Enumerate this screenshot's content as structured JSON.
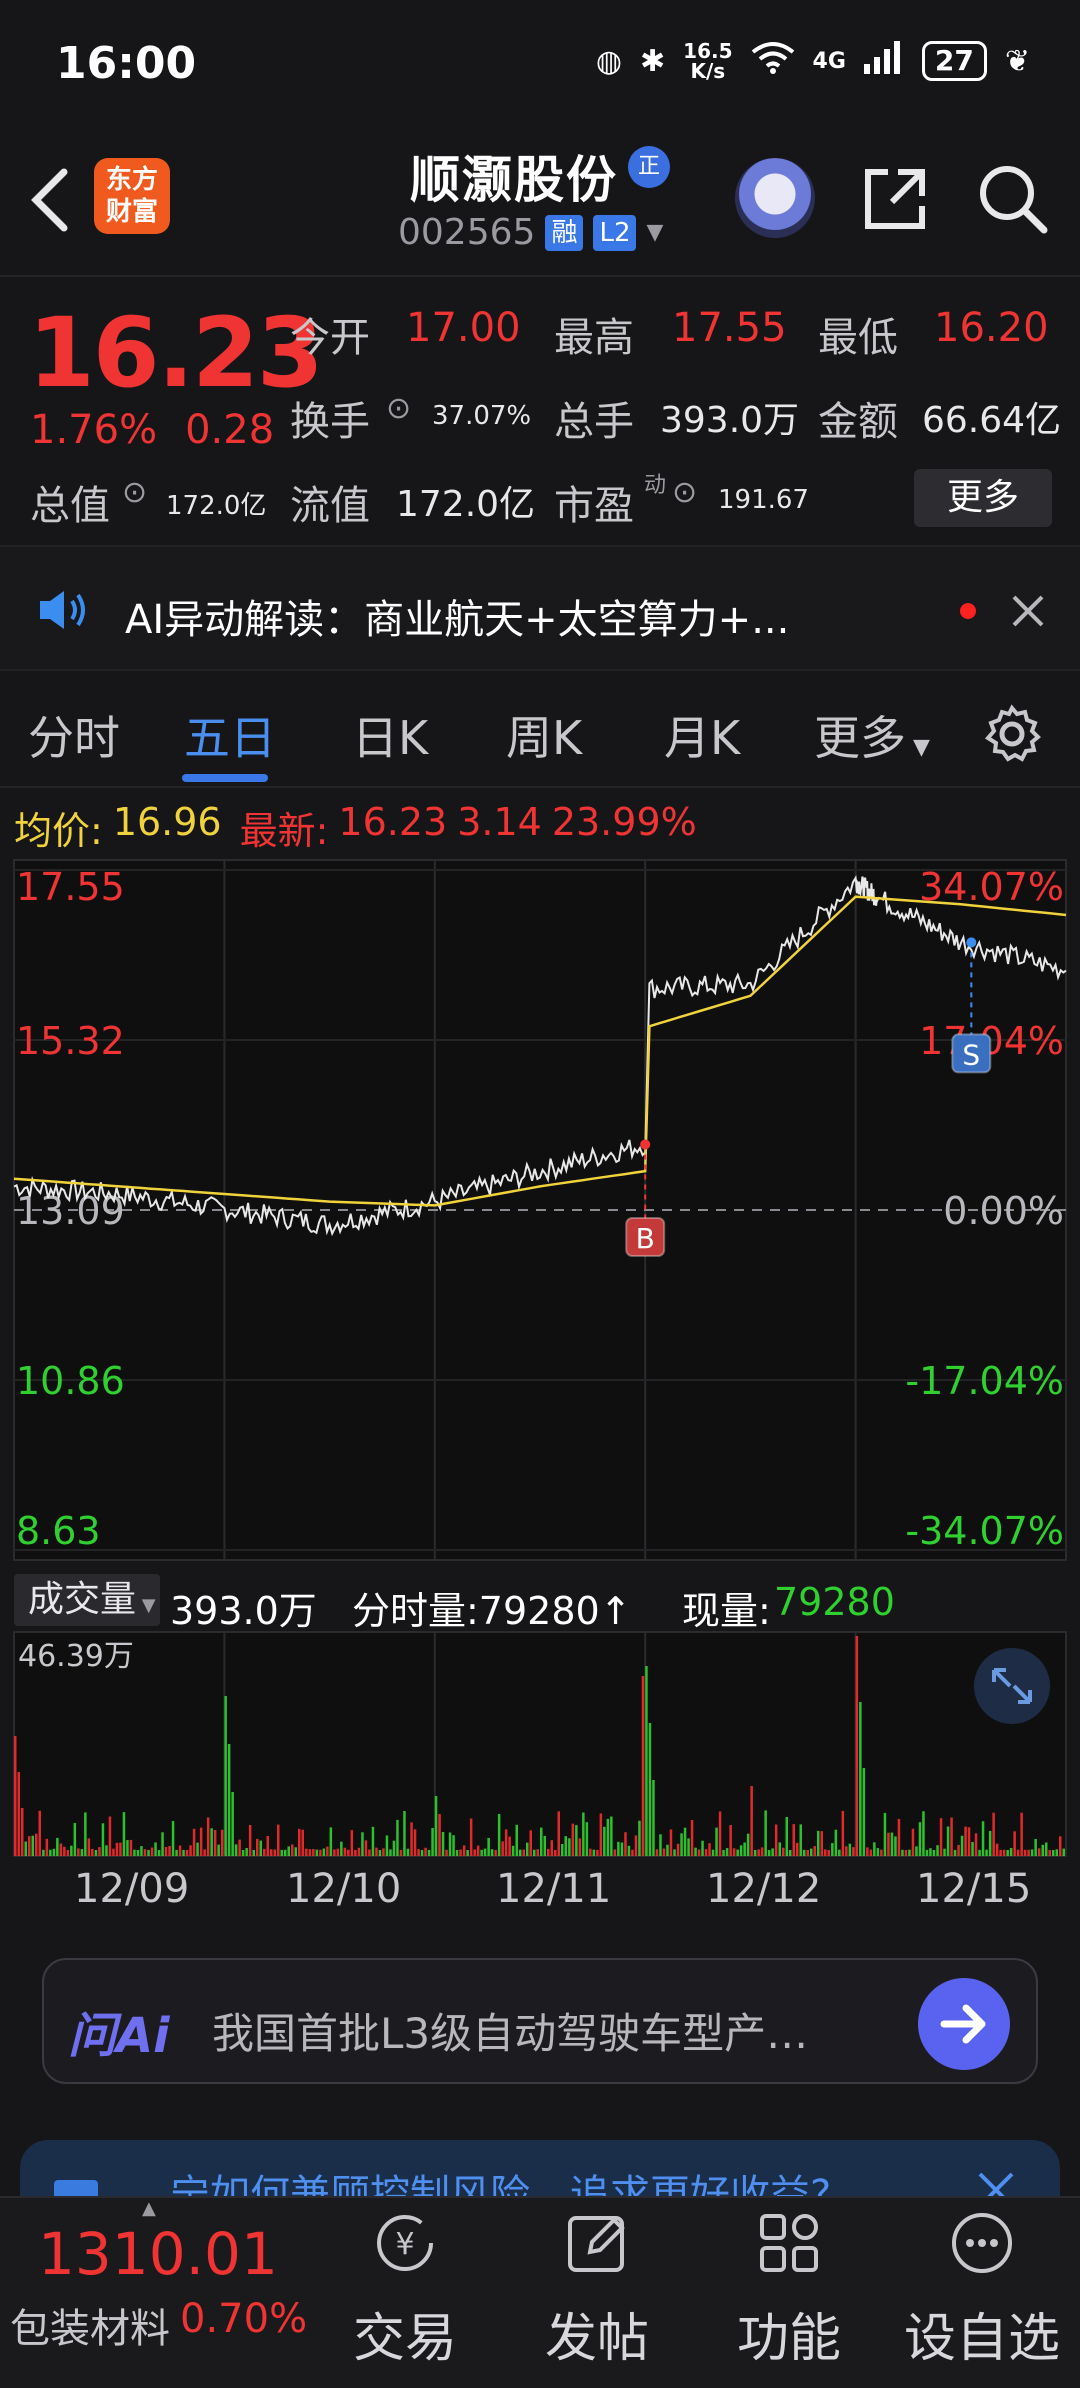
{
  "status_bar": {
    "time": "16:00",
    "net_speed_top": "16.5",
    "net_speed_bottom": "K/s",
    "network": "4G",
    "battery": "27"
  },
  "header": {
    "logo_line1": "东方",
    "logo_line2": "财富",
    "stock_name": "顺灏股份",
    "name_badge": "正",
    "stock_code": "002565",
    "tag_rong": "融",
    "tag_l2": "L2"
  },
  "quote": {
    "last_price": "16.23",
    "change_pct": "1.76%",
    "change_amt": "0.28",
    "open_label": "今开",
    "open_value": "17.00",
    "high_label": "最高",
    "high_value": "17.55",
    "low_label": "最低",
    "low_value": "16.20",
    "turnover_label": "换手",
    "turnover_value": "37.07%",
    "volume_label": "总手",
    "volume_value": "393.0万",
    "amount_label": "金额",
    "amount_value": "66.64亿",
    "mktcap_label": "总值",
    "mktcap_value": "172.0亿",
    "float_label": "流值",
    "float_value": "172.0亿",
    "pe_label": "市盈",
    "pe_sup": "动",
    "pe_value": "191.67",
    "more_label": "更多"
  },
  "ai_banner": {
    "text": "AI异动解读：商业航天+太空算力+..."
  },
  "tabs": [
    "分时",
    "五日",
    "日K",
    "周K",
    "月K",
    "更多"
  ],
  "active_tab": "五日",
  "chart_info": {
    "avg_label": "均价:",
    "avg_value": "16.96",
    "latest_label": "最新:",
    "latest_value": "16.23",
    "latest_change": "3.14",
    "latest_pct": "23.99%"
  },
  "volume_header": {
    "selector": "成交量",
    "total": "393.0万",
    "tick_label": "分时量:79280↑",
    "current_label": "现量:",
    "current_value": "79280",
    "max_label": "46.39万"
  },
  "ask_ai": {
    "logo": "问Ai",
    "text": "我国首批L3级自动驾驶车型产…"
  },
  "promo": {
    "text": "宁如何兼顾控制风险，追求更好收益?"
  },
  "bottom_bar": {
    "index_value": "1310.01",
    "index_name": "包装材料",
    "index_change": "0.70%",
    "nav": [
      "交易",
      "发帖",
      "功能",
      "设自选"
    ]
  },
  "chart_data": {
    "type": "line",
    "title": "",
    "x_dates": [
      "12/09",
      "12/10",
      "12/11",
      "12/12",
      "12/15"
    ],
    "y_left_ticks": [
      "17.55",
      "15.32",
      "13.09",
      "10.86",
      "8.63"
    ],
    "y_right_ticks": [
      "34.07%",
      "17.04%",
      "0.00%",
      "-17.04%",
      "-34.07%"
    ],
    "ylim": [
      8.63,
      17.55
    ],
    "reference_close": 13.09,
    "series": [
      {
        "name": "",
        "color": "#e8e8e8",
        "x": [
          0,
          0.5,
          1,
          1.5,
          2,
          2.5,
          3,
          3.02,
          3.5,
          4,
          4.1,
          4.5,
          5
        ],
        "values": [
          13.4,
          13.3,
          13.1,
          12.9,
          13.2,
          13.6,
          13.95,
          16.0,
          16.05,
          17.4,
          17.2,
          16.6,
          16.23
        ]
      },
      {
        "name": "",
        "color": "#f0d23c",
        "x": [
          0,
          0.5,
          1,
          1.5,
          2,
          2.5,
          3,
          3.02,
          3.5,
          4,
          4.5,
          5
        ],
        "values": [
          13.5,
          13.4,
          13.3,
          13.2,
          13.15,
          13.4,
          13.6,
          15.5,
          15.9,
          17.2,
          17.1,
          16.96
        ]
      }
    ],
    "markers": [
      {
        "label": "B",
        "x": 3.0,
        "price": 13.95
      },
      {
        "label": "S",
        "x": 4.55,
        "price": 16.6
      }
    ],
    "volume_max": "46.39万"
  }
}
